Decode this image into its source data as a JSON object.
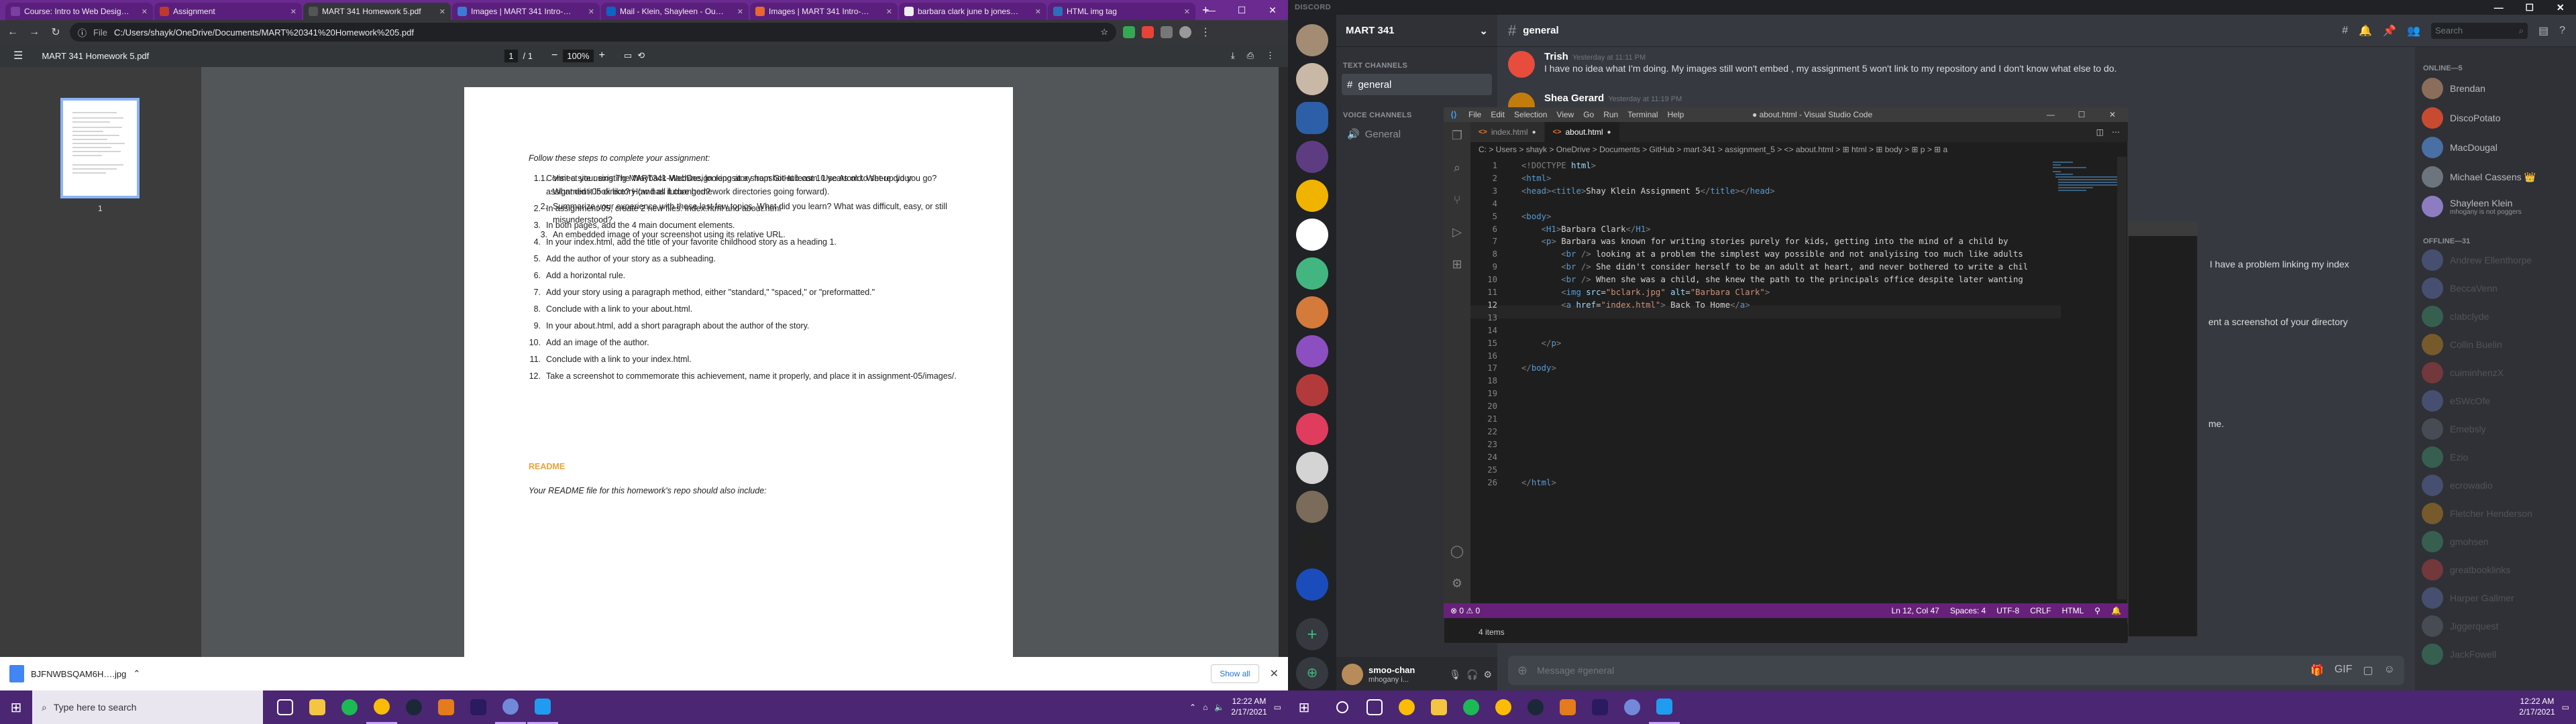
{
  "chrome": {
    "tabs": [
      {
        "title": "Course: Intro to Web Desig…",
        "color": "#7a3fa0",
        "active": false
      },
      {
        "title": "Assignment",
        "color": "#c0392b",
        "active": false
      },
      {
        "title": "MART 341 Homework 5.pdf",
        "color": "#555555",
        "active": true
      },
      {
        "title": "Images | MART 341 Intro-…",
        "color": "#3a7bd5",
        "active": false
      },
      {
        "title": "Mail - Klein, Shayleen - Ou…",
        "color": "#0a66c2",
        "active": false
      },
      {
        "title": "Images | MART 341 Intro-…",
        "color": "#e8672c",
        "active": false
      },
      {
        "title": "barbara clark june b jones…",
        "color": "#eeeeee",
        "active": false
      },
      {
        "title": "HTML img tag",
        "color": "#2c6ebd",
        "active": false
      }
    ],
    "new_tab": "+",
    "address": {
      "prefix": "File",
      "url": "C:/Users/shayk/OneDrive/Documents/MART%20341%20Homework%205.pdf"
    },
    "window_controls": {
      "minimize": "—",
      "maximize": "☐",
      "close": "✕"
    }
  },
  "pdf": {
    "title": "MART 341 Homework 5.pdf",
    "page_current": "1",
    "page_total": "/ 1",
    "zoom": "100%",
    "thumb_number": "1",
    "intro": "Follow these steps to complete your assignment:",
    "steps": [
      {
        "n": "1.",
        "text": "Connect your existing MART341-WebDesign repository from GitHub.com. Use Atom to set-up your assignment-05 directory (and all future homework directories going forward)."
      },
      {
        "n": "2.",
        "text": "In assignment-05, create 2 new files: index.html and about.html"
      },
      {
        "n": "3.",
        "text": "In both pages, add the 4 main document elements."
      },
      {
        "n": "4.",
        "text": "In your index.html, add the title of your favorite childhood story as a heading 1."
      },
      {
        "n": "5.",
        "text": "Add the author of your story as a subheading."
      },
      {
        "n": "6.",
        "text": "Add a horizontal rule."
      },
      {
        "n": "7.",
        "text": "Add your story using a paragraph method, either \"standard,\" \"spaced,\" or \"preformatted.\""
      },
      {
        "n": "8.",
        "text": "Conclude with a link to your about.html."
      },
      {
        "n": "9.",
        "text": "In your about.html, add a short paragraph about the author of the story."
      },
      {
        "n": "10.",
        "text": "Add an image of the author."
      },
      {
        "n": "11.",
        "text": "Conclude with a link to your index.html."
      },
      {
        "n": "12.",
        "text": "Take a screenshot to commemorate this achievement, name it properly, and place it in assignment-05/images/."
      }
    ],
    "readme_heading": "README",
    "readme_intro": "Your README file for this homework's repo should also include:",
    "readme_items": [
      {
        "n": "1.",
        "text": "Visit a site using The Wayback Machine, looking at a snapshot at least 10 years old. Where did you go? What did it look like? How has it changed?"
      },
      {
        "n": "2.",
        "text": "Summarize your experience with these last few topics. What did you learn? What was difficult, easy, or still misunderstood?"
      },
      {
        "n": "3.",
        "text": "An embedded image of your screenshot using its relative URL."
      }
    ]
  },
  "downloads": {
    "file": "BJFNWBSQAM6H….jpg",
    "show_all": "Show all"
  },
  "taskbar": {
    "search_placeholder": "Type here to search",
    "time": "12:22 AM",
    "date": "2/17/2021"
  },
  "discord": {
    "brand": "DISCORD",
    "server_name": "MART 341",
    "categories": {
      "text": "TEXT CHANNELS",
      "voice": "VOICE CHANNELS"
    },
    "channels": {
      "general": "general",
      "voice_general": "General"
    },
    "channel_header": "general",
    "search_placeholder": "Search",
    "messages": [
      {
        "author": "Trish",
        "time": "Yesterday at 11:11 PM",
        "body": "I have no idea what I'm doing. My images still won't embed , my assignment 5 won't link to my repository and I don't know what else to do.",
        "color": "#e74c3c"
      },
      {
        "author": "Shea Gerard",
        "time": "Yesterday at 11:19 PM",
        "body": "",
        "color": "#c27c0e"
      }
    ],
    "fragments": [
      "I have a problem linking my index",
      "ent a screenshot of your directory",
      "me."
    ],
    "message_placeholder": "Message #general",
    "user": {
      "name": "smoo-chan",
      "status": "mhogany i..."
    },
    "members": {
      "online_header": "ONLINE—5",
      "online": [
        {
          "name": "Brendan",
          "sub": "",
          "color": "#8a6d5a"
        },
        {
          "name": "DiscoPotato",
          "sub": "",
          "color": "#c84b31"
        },
        {
          "name": "MacDougal",
          "sub": "",
          "color": "#4a6fa5"
        },
        {
          "name": "Michael Cassens 👑",
          "sub": "",
          "color": "#6c757d"
        },
        {
          "name": "Shayleen Klein",
          "sub": "mhogany is not poggers",
          "color": "#8e7cc3"
        }
      ],
      "offline_header": "OFFLINE—31",
      "offline": [
        {
          "name": "Andrew Ellenthorpe",
          "color": "#7289da"
        },
        {
          "name": "BeccaVenn",
          "color": "#7289da"
        },
        {
          "name": "clabclyde",
          "color": "#43b581"
        },
        {
          "name": "Collin Buelin",
          "color": "#faa61a"
        },
        {
          "name": "cuiminhenzX",
          "color": "#f04747"
        },
        {
          "name": "eSWcOfe",
          "color": "#7289da"
        },
        {
          "name": "Emebsly",
          "color": "#747f8d"
        },
        {
          "name": "Ezio",
          "color": "#43b581"
        },
        {
          "name": "ecrowadio",
          "color": "#7289da"
        },
        {
          "name": "Fletcher Henderson",
          "color": "#faa61a"
        },
        {
          "name": "gmohsen",
          "color": "#43b581"
        },
        {
          "name": "greatbooklinks",
          "color": "#f04747"
        },
        {
          "name": "Harper Gallmer",
          "color": "#7289da"
        },
        {
          "name": "Jiggerquest",
          "color": "#747f8d"
        },
        {
          "name": "JackFowell",
          "color": "#43b581"
        }
      ]
    }
  },
  "vscode": {
    "title": "● about.html - Visual Studio Code",
    "menu": [
      "File",
      "Edit",
      "Selection",
      "View",
      "Go",
      "Run",
      "Terminal",
      "Help"
    ],
    "tabs": [
      {
        "name": "index.html",
        "dirty": true,
        "active": false
      },
      {
        "name": "about.html",
        "dirty": true,
        "active": true
      }
    ],
    "breadcrumb": "C: > Users > shayk > OneDrive > Documents > GitHub > mart-341 > assignment_5 > <> about.html > ⊞ html > ⊞ body > ⊞ p > ⊞ a",
    "code_lines": [
      {
        "n": "1",
        "html": "<span class='gr'>&lt;!DOCTYPE</span> <span class='at'>html</span><span class='gr'>&gt;</span>"
      },
      {
        "n": "2",
        "html": "<span class='gr'>&lt;</span><span class='tg'>html</span><span class='gr'>&gt;</span>"
      },
      {
        "n": "3",
        "html": "<span class='gr'>&lt;</span><span class='tg'>head</span><span class='gr'>&gt;&lt;</span><span class='tg'>title</span><span class='gr'>&gt;</span>Shay Klein Assignment 5<span class='gr'>&lt;/</span><span class='tg'>title</span><span class='gr'>&gt;&lt;/</span><span class='tg'>head</span><span class='gr'>&gt;</span>"
      },
      {
        "n": "4",
        "html": ""
      },
      {
        "n": "5",
        "html": "<span class='gr'>&lt;</span><span class='tg'>body</span><span class='gr'>&gt;</span>"
      },
      {
        "n": "6",
        "html": "    <span class='gr'>&lt;</span><span class='tg'>H1</span><span class='gr'>&gt;</span>Barbara Clark<span class='gr'>&lt;/</span><span class='tg'>H1</span><span class='gr'>&gt;</span>"
      },
      {
        "n": "7",
        "html": "    <span class='gr'>&lt;</span><span class='tg'>p</span><span class='gr'>&gt;</span> Barbara was known for writing stories purely for kids, getting into the mind of a child by"
      },
      {
        "n": "8",
        "html": "        <span class='gr'>&lt;</span><span class='tg'>br</span> <span class='gr'>/&gt;</span> looking at a problem the simplest way possible and not analyising too much like adults"
      },
      {
        "n": "9",
        "html": "        <span class='gr'>&lt;</span><span class='tg'>br</span> <span class='gr'>/&gt;</span> She didn't consider herself to be an adult at heart, and never bothered to write a chil"
      },
      {
        "n": "10",
        "html": "        <span class='gr'>&lt;</span><span class='tg'>br</span> <span class='gr'>/&gt;</span> When she was a child, she knew the path to the principals office despite later wanting"
      },
      {
        "n": "11",
        "html": "        <span class='gr'>&lt;</span><span class='tg'>img</span> <span class='at'>src</span>=<span class='st'>\"bclark.jpg\"</span> <span class='at'>alt</span>=<span class='st'>\"Barbara Clark\"</span><span class='gr'>&gt;</span>"
      },
      {
        "n": "12",
        "html": "        <span class='gr'>&lt;</span><span class='tg'>a</span> <span class='at'>href</span>=<span class='st'>\"index.html\"</span><span class='gr'>&gt;</span> Back To Home<span class='gr'>&lt;/</span><span class='tg'>a</span><span class='gr'>&gt;</span>"
      },
      {
        "n": "13",
        "html": ""
      },
      {
        "n": "14",
        "html": ""
      },
      {
        "n": "15",
        "html": "    <span class='gr'>&lt;/</span><span class='tg'>p</span><span class='gr'>&gt;</span>"
      },
      {
        "n": "16",
        "html": ""
      },
      {
        "n": "17",
        "html": "<span class='gr'>&lt;/</span><span class='tg'>body</span><span class='gr'>&gt;</span>"
      },
      {
        "n": "18",
        "html": ""
      },
      {
        "n": "19",
        "html": ""
      },
      {
        "n": "20",
        "html": ""
      },
      {
        "n": "21",
        "html": ""
      },
      {
        "n": "22",
        "html": ""
      },
      {
        "n": "23",
        "html": ""
      },
      {
        "n": "24",
        "html": ""
      },
      {
        "n": "25",
        "html": ""
      },
      {
        "n": "26",
        "html": "<span class='gr'>&lt;/</span><span class='tg'>html</span><span class='gr'>&gt;</span>"
      }
    ],
    "current_line": "12",
    "status": {
      "errors": "⊗ 0 ⚠ 0",
      "position": "Ln 12, Col 47",
      "spaces": "Spaces: 4",
      "encoding": "UTF-8",
      "eol": "CRLF",
      "language": "HTML"
    },
    "panel": "4 items"
  }
}
